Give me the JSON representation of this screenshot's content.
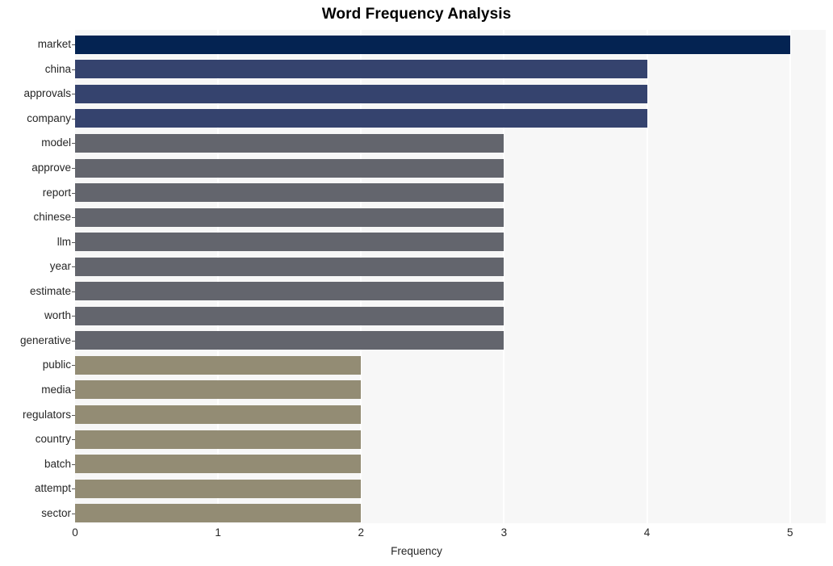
{
  "chart_data": {
    "type": "bar",
    "orientation": "horizontal",
    "title": "Word Frequency Analysis",
    "xlabel": "Frequency",
    "ylabel": "",
    "xlim": [
      0,
      5.25
    ],
    "xticks": [
      0,
      1,
      2,
      3,
      4,
      5
    ],
    "xtick_labels": [
      "0",
      "1",
      "2",
      "3",
      "4",
      "5"
    ],
    "grid": "vertical-white-on-light-gray",
    "legend": "none",
    "plot_background": "#f7f7f7",
    "figure_background": "#ffffff",
    "categories": [
      "market",
      "china",
      "approvals",
      "company",
      "model",
      "approve",
      "report",
      "chinese",
      "llm",
      "year",
      "estimate",
      "worth",
      "generative",
      "public",
      "media",
      "regulators",
      "country",
      "batch",
      "attempt",
      "sector"
    ],
    "values": [
      5,
      4,
      4,
      4,
      3,
      3,
      3,
      3,
      3,
      3,
      3,
      3,
      3,
      2,
      2,
      2,
      2,
      2,
      2,
      2
    ],
    "bar_colors": [
      "#042352",
      "#35436e",
      "#35436e",
      "#35436e",
      "#63656d",
      "#63656d",
      "#63656d",
      "#63656d",
      "#63656d",
      "#63656d",
      "#63656d",
      "#63656d",
      "#63656d",
      "#938c74",
      "#938c74",
      "#938c74",
      "#938c74",
      "#938c74",
      "#938c74",
      "#938c74"
    ],
    "palette": {
      "rank_1": "#042352",
      "rank_2": "#35436e",
      "rank_3": "#63656d",
      "rank_4": "#938c74"
    }
  }
}
